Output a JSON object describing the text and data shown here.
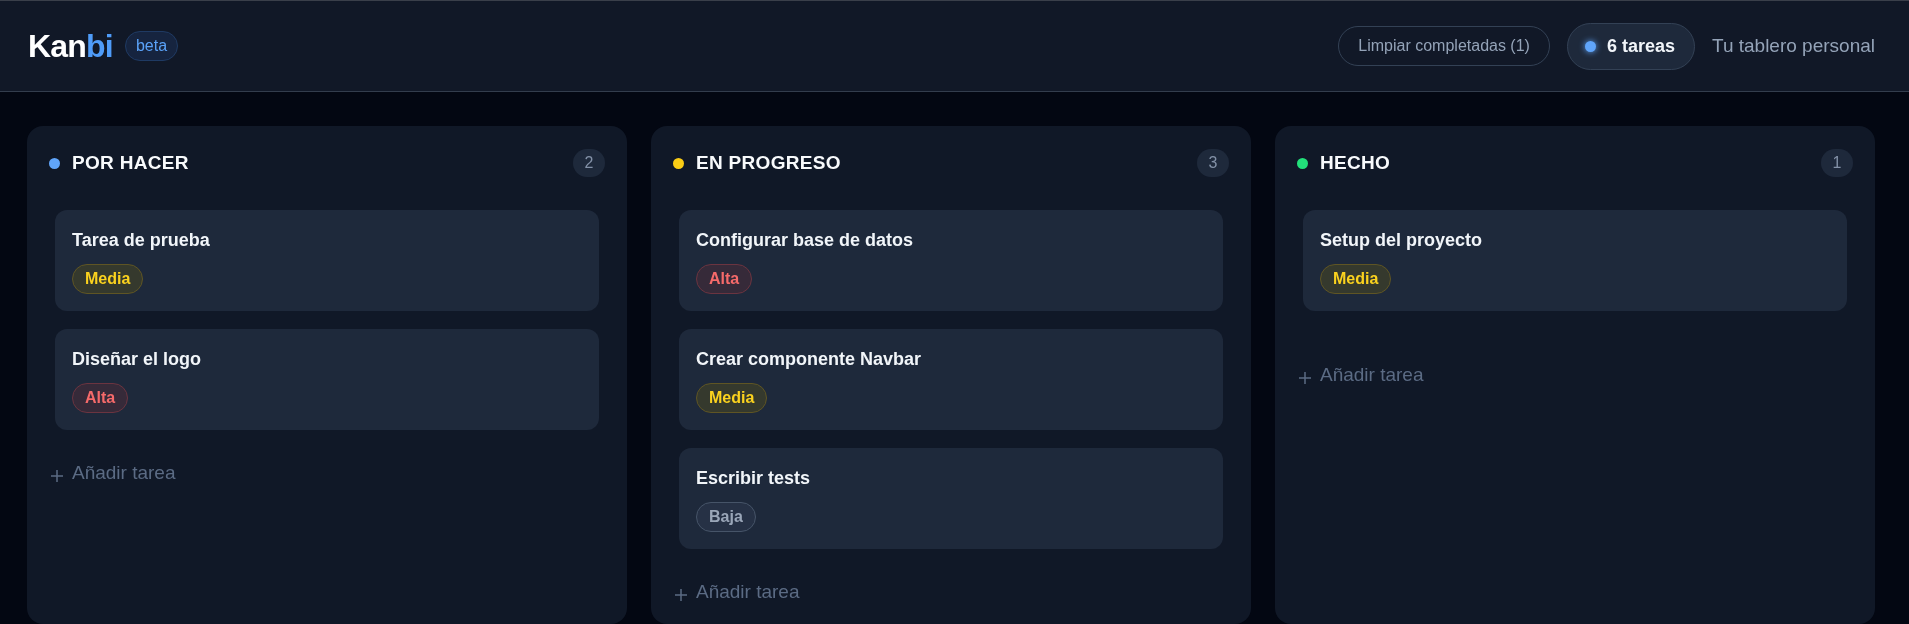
{
  "header": {
    "logo": {
      "parts": [
        {
          "text": "Kan",
          "kind": "plain"
        },
        {
          "text": "bi",
          "kind": "accent"
        }
      ]
    },
    "badge": "beta",
    "clear_button": "Limpiar completadas (1)",
    "task_count": "6 tareas",
    "subtitle": "Tu tablero personal"
  },
  "columns": [
    {
      "title": "POR HACER",
      "color": "#60a5fa",
      "count": "2",
      "cards": [
        {
          "title": "Tarea de prueba",
          "priority": {
            "label": "Media",
            "kind": "medium"
          }
        },
        {
          "title": "Diseñar el logo",
          "priority": {
            "label": "Alta",
            "kind": "high"
          }
        }
      ],
      "add_button": "Añadir tarea"
    },
    {
      "title": "EN PROGRESO",
      "color": "#facc15",
      "count": "3",
      "cards": [
        {
          "title": "Configurar base de datos",
          "priority": {
            "label": "Alta",
            "kind": "high"
          }
        },
        {
          "title": "Crear componente Navbar",
          "priority": {
            "label": "Media",
            "kind": "medium"
          }
        },
        {
          "title": "Escribir tests",
          "priority": {
            "label": "Baja",
            "kind": "low"
          }
        }
      ],
      "add_button": "Añadir tarea"
    },
    {
      "title": "HECHO",
      "color": "#22e07a",
      "count": "1",
      "cards": [
        {
          "title": "Setup del proyecto",
          "priority": {
            "label": "Media",
            "kind": "medium"
          }
        }
      ],
      "add_button": "Añadir tarea"
    }
  ]
}
